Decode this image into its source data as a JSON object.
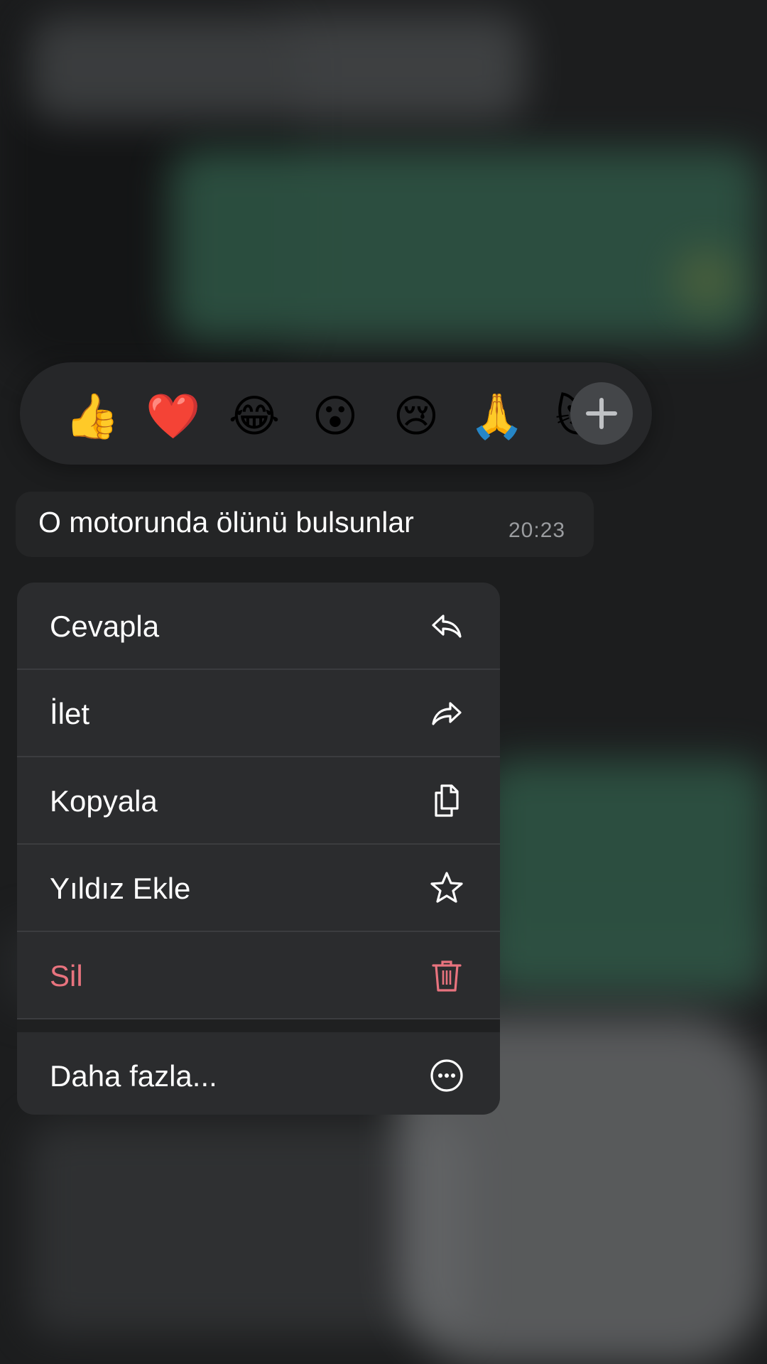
{
  "reactions": {
    "emojis": [
      "👍",
      "❤️",
      "😂",
      "😮",
      "😢",
      "🙏",
      "😻"
    ],
    "add_icon": "plus-icon"
  },
  "message": {
    "text": "O motorunda ölünü bulsunlar",
    "time": "20:23"
  },
  "menu": {
    "items": [
      {
        "label": "Cevapla",
        "icon": "reply-icon"
      },
      {
        "label": "İlet",
        "icon": "forward-icon"
      },
      {
        "label": "Kopyala",
        "icon": "copy-icon"
      },
      {
        "label": "Yıldız Ekle",
        "icon": "star-icon"
      },
      {
        "label": "Sil",
        "icon": "trash-icon"
      }
    ],
    "more": {
      "label": "Daha fazla...",
      "icon": "more-icon"
    }
  },
  "colors": {
    "danger": "#e8737e",
    "menu_background": "#2b2c2e",
    "chat_green": "#2f5746"
  }
}
